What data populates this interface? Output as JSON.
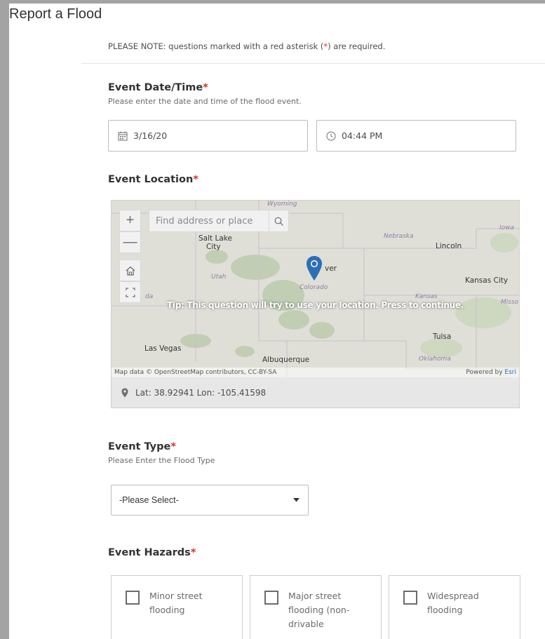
{
  "page": {
    "title": "Report a Flood"
  },
  "note": {
    "prefix": "PLEASE NOTE: questions marked with a red asterisk (",
    "asterisk": "*",
    "suffix": ") are required."
  },
  "event_datetime": {
    "title": "Event Date/Time",
    "asterisk": "*",
    "description": "Please enter the date and time of the flood event.",
    "date_value": "3/16/20",
    "time_value": "04:44 PM",
    "date_icon": "calendar-icon",
    "time_icon": "clock-icon"
  },
  "event_location": {
    "title": "Event Location",
    "asterisk": "*",
    "map": {
      "search_placeholder": "Find address or place",
      "zoom_in": "+",
      "zoom_out": "—",
      "tip": "Tip: This question will try to use your location. Press to continue.",
      "attribution": "Map data © OpenStreetMap contributors, CC-BY-SA",
      "powered_by": "Powered by ",
      "esri": "Esri",
      "labels": {
        "wyoming": "Wyoming",
        "nebraska": "Nebraska",
        "iowa": "Iowa",
        "salt_lake": "Salt Lake",
        "city": "City",
        "lincoln": "Lincoln",
        "utah": "Utah",
        "denver": "ver",
        "colorado": "Colorado",
        "kansas_city": "Kansas City",
        "kansas": "Kansas",
        "misso": "Misso",
        "da": "da",
        "tulsa": "Tulsa",
        "las_vegas": "Las Vegas",
        "albuquerque": "Albuquerque",
        "oklahoma": "Oklahoma"
      }
    },
    "coordinates": "Lat: 38.92941  Lon: -105.41598"
  },
  "event_type": {
    "title": "Event Type",
    "asterisk": "*",
    "description": "Please Enter the Flood Type",
    "selected": "-Please Select-"
  },
  "event_hazards": {
    "title": "Event Hazards",
    "asterisk": "*",
    "options": [
      {
        "line1": "Minor street",
        "line2": "flooding",
        "line3": ""
      },
      {
        "line1": "Major street",
        "line2": "flooding (non-",
        "line3": "drivable"
      },
      {
        "line1": "Widespread",
        "line2": "flooding",
        "line3": ""
      }
    ]
  },
  "colors": {
    "required_asterisk": "#d83020",
    "map_pin": "#2b6fb5",
    "window_bg": "#a3a3a3"
  }
}
